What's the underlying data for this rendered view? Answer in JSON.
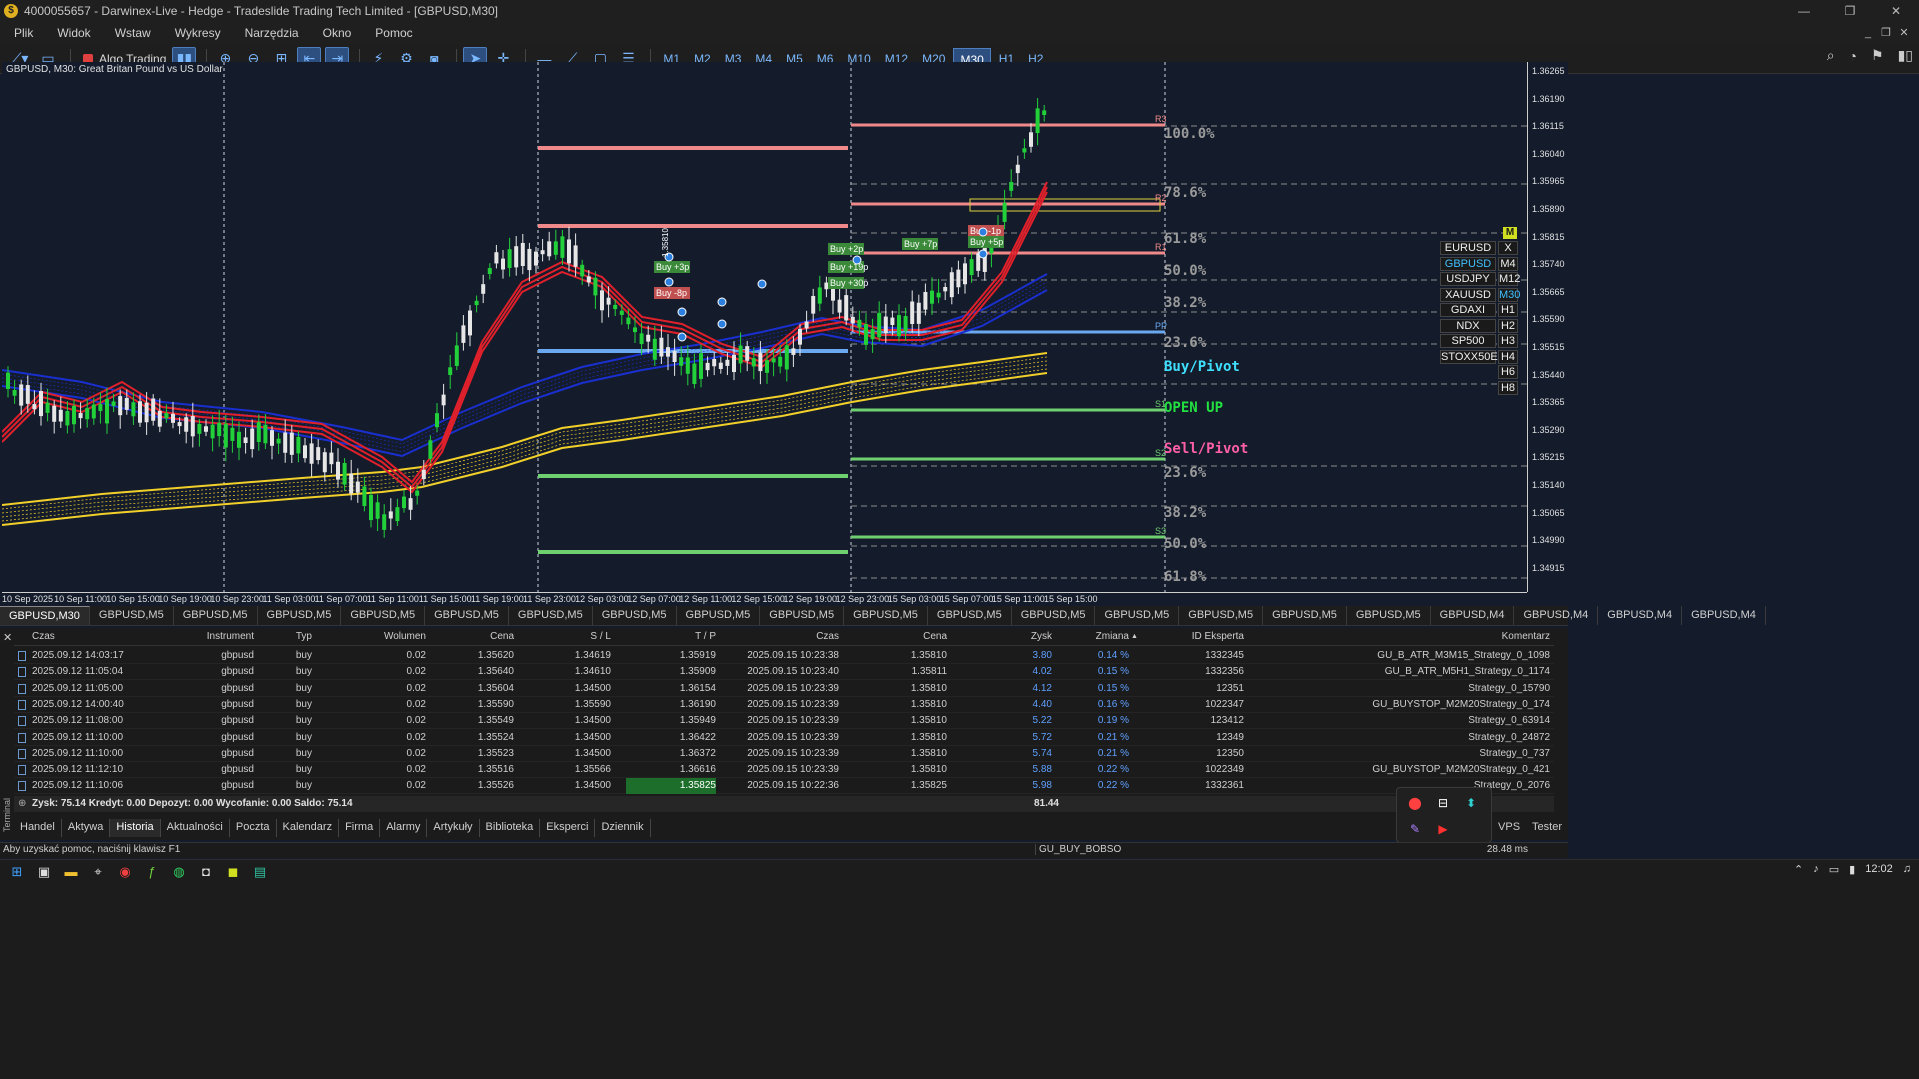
{
  "window": {
    "title": "4000055657 - Darwinex-Live - Hedge - Tradeslide Trading Tech Limited - [GBPUSD,M30]",
    "controls": [
      "—",
      "❐",
      "✕"
    ],
    "mdi_controls": [
      "_",
      "❐",
      "✕"
    ]
  },
  "menu": [
    "Plik",
    "Widok",
    "Wstaw",
    "Wykresy",
    "Narzędzia",
    "Okno",
    "Pomoc"
  ],
  "toolbar": {
    "algo_label": "Algo Trading",
    "timeframes": [
      "M1",
      "M2",
      "M3",
      "M4",
      "M5",
      "M6",
      "M10",
      "M12",
      "M20",
      "M30",
      "H1",
      "H2"
    ],
    "active_timeframe": "M30"
  },
  "chart": {
    "caption": "GBPUSD, M30:  Great Britan Pound vs US Dollar",
    "y_labels": [
      "1.36265",
      "1.36190",
      "1.36115",
      "1.36040",
      "1.35965",
      "1.35890",
      "1.35815",
      "1.35740",
      "1.35665",
      "1.35590",
      "1.35515",
      "1.35440",
      "1.35365",
      "1.35290",
      "1.35215",
      "1.35140",
      "1.35065",
      "1.34990",
      "1.34915"
    ],
    "x_labels": [
      "10 Sep 2025",
      "10 Sep 11:00",
      "10 Sep 15:00",
      "10 Sep 19:00",
      "10 Sep 23:00",
      "11 Sep 03:00",
      "11 Sep 07:00",
      "11 Sep 11:00",
      "11 Sep 15:00",
      "11 Sep 19:00",
      "11 Sep 23:00",
      "12 Sep 03:00",
      "12 Sep 07:00",
      "12 Sep 11:00",
      "12 Sep 15:00",
      "12 Sep 19:00",
      "12 Sep 23:00",
      "15 Sep 03:00",
      "15 Sep 07:00",
      "15 Sep 11:00",
      "15 Sep 15:00"
    ],
    "fib_upper": [
      "100.0%",
      "78.6%",
      "61.8%",
      "50.0%",
      "38.2%",
      "23.6%"
    ],
    "fib_lower": [
      "23.6%",
      "38.2%",
      "50.0%",
      "61.8%"
    ],
    "pivot_labels": {
      "buy_pivot": "Buy/Pivot",
      "open_up": "OPEN UP",
      "sell_pivot": "Sell/Pivot"
    },
    "level_tags": [
      "R3",
      "R2",
      "R1",
      "PP",
      "S1",
      "S2",
      "S3"
    ],
    "trade_tags": [
      "Buy +3p",
      "Buy -8p",
      "Buy +2p",
      "Buy +19p",
      "Buy +30p",
      "Buy +7p",
      "Buy -1p",
      "Buy +5p"
    ],
    "trade_ticket": "1.35810",
    "colors": {
      "background": "#141c2c",
      "bull": "#22d13a",
      "bear": "#e6e6e6",
      "ma_red": "#e0202a",
      "ma_blue": "#1a2fd0",
      "ma_yellow": "#f2d02a",
      "resist": "#f08a8a",
      "support": "#6fd06f",
      "pivot": "#6aa8f0"
    }
  },
  "symbol_panel": {
    "close": "X",
    "badge": "M",
    "symbols": [
      "EURUSD",
      "GBPUSD",
      "USDJPY",
      "XAUUSD",
      "GDAXI",
      "NDX",
      "SP500",
      "STOXX50E"
    ],
    "selected_symbol": "GBPUSD",
    "timeframes": [
      "M4",
      "M12",
      "M30",
      "H1",
      "H2",
      "H3",
      "H4",
      "H6",
      "H8"
    ],
    "selected_timeframe": "M30"
  },
  "chart_tabs": [
    "GBPUSD,M30",
    "GBPUSD,M5",
    "GBPUSD,M5",
    "GBPUSD,M5",
    "GBPUSD,M5",
    "GBPUSD,M5",
    "GBPUSD,M5",
    "GBPUSD,M5",
    "GBPUSD,M5",
    "GBPUSD,M5",
    "GBPUSD,M5",
    "GBPUSD,M5",
    "GBPUSD,M5",
    "GBPUSD,M5",
    "GBPUSD,M5",
    "GBPUSD,M5",
    "GBPUSD,M5",
    "GBPUSD,M4",
    "GBPUSD,M4",
    "GBPUSD,M4",
    "GBPUSD,M4"
  ],
  "history": {
    "close": "✕",
    "columns": [
      "Czas",
      "Instrument",
      "Typ",
      "Wolumen",
      "Cena",
      "S / L",
      "T / P",
      "Czas",
      "Cena",
      "Zysk",
      "Zmiana",
      "ID Eksperta",
      "Komentarz"
    ],
    "sort_marker": "▲",
    "rows": [
      [
        "2025.09.12 14:03:17",
        "gbpusd",
        "buy",
        "0.02",
        "1.35620",
        "1.34619",
        "1.35919",
        "2025.09.15 10:23:38",
        "1.35810",
        "3.80",
        "0.14 %",
        "1332345",
        "GU_B_ATR_M3M15_Strategy_0_1098"
      ],
      [
        "2025.09.12 11:05:04",
        "gbpusd",
        "buy",
        "0.02",
        "1.35640",
        "1.34610",
        "1.35909",
        "2025.09.15 10:23:40",
        "1.35811",
        "4.02",
        "0.15 %",
        "1332356",
        "GU_B_ATR_M5H1_Strategy_0_1174"
      ],
      [
        "2025.09.12 11:05:00",
        "gbpusd",
        "buy",
        "0.02",
        "1.35604",
        "1.34500",
        "1.36154",
        "2025.09.15 10:23:39",
        "1.35810",
        "4.12",
        "0.15 %",
        "12351",
        "Strategy_0_15790"
      ],
      [
        "2025.09.12 14:00:40",
        "gbpusd",
        "buy",
        "0.02",
        "1.35590",
        "1.35590",
        "1.36190",
        "2025.09.15 10:23:39",
        "1.35810",
        "4.40",
        "0.16 %",
        "1022347",
        "GU_BUYSTOP_M2M20Strategy_0_174"
      ],
      [
        "2025.09.12 11:08:00",
        "gbpusd",
        "buy",
        "0.02",
        "1.35549",
        "1.34500",
        "1.35949",
        "2025.09.15 10:23:39",
        "1.35810",
        "5.22",
        "0.19 %",
        "123412",
        "Strategy_0_63914"
      ],
      [
        "2025.09.12 11:10:00",
        "gbpusd",
        "buy",
        "0.02",
        "1.35524",
        "1.34500",
        "1.36422",
        "2025.09.15 10:23:39",
        "1.35810",
        "5.72",
        "0.21 %",
        "12349",
        "Strategy_0_24872"
      ],
      [
        "2025.09.12 11:10:00",
        "gbpusd",
        "buy",
        "0.02",
        "1.35523",
        "1.34500",
        "1.36372",
        "2025.09.15 10:23:39",
        "1.35810",
        "5.74",
        "0.21 %",
        "12350",
        "Strategy_0_737"
      ],
      [
        "2025.09.12 11:12:10",
        "gbpusd",
        "buy",
        "0.02",
        "1.35516",
        "1.35566",
        "1.36616",
        "2025.09.15 10:23:39",
        "1.35810",
        "5.88",
        "0.22 %",
        "1022349",
        "GU_BUYSTOP_M2M20Strategy_0_421"
      ],
      [
        "2025.09.12 11:10:06",
        "gbpusd",
        "buy",
        "0.02",
        "1.35526",
        "1.34500",
        "1.35825",
        "2025.09.15 10:22:36",
        "1.35825",
        "5.98",
        "0.22 %",
        "1332361",
        "Strategy_0_2076"
      ]
    ],
    "highlight": {
      "row": 8,
      "col": 6
    },
    "summary": "Zysk: 75.14  Kredyt: 0.00  Depozyt: 0.00  Wycofanie: 0.00  Saldo: 75.14",
    "summary_total": "81.44"
  },
  "terminal_label": "Terminal",
  "bottom_tabs": [
    "Handel",
    "Aktywa",
    "Historia",
    "Aktualności",
    "Poczta",
    "Kalendarz",
    "Firma",
    "Alarmy",
    "Artykuły",
    "Biblioteka",
    "Eksperci",
    "Dziennik"
  ],
  "active_bottom_tab": "Historia",
  "bottom_right": [
    "Ma",
    "VPS",
    "Tester"
  ],
  "status": {
    "help": "Aby uzyskać pomoc, naciśnij klawisz F1",
    "profile": "GU_BUY_BOBSO",
    "ping": "28.48 ms"
  },
  "taskbar": {
    "clock": "12:02"
  }
}
